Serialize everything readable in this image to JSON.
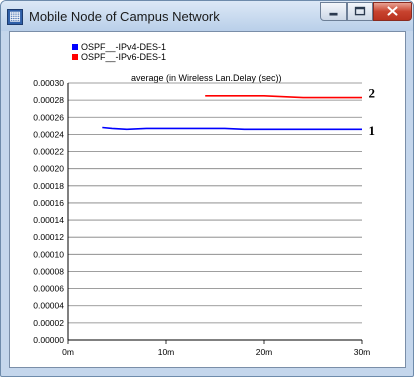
{
  "window": {
    "title": "Mobile Node of Campus Network",
    "icon": "app-window-icon",
    "controls": {
      "minimize": "minimize-icon",
      "maximize": "maximize-icon",
      "close": "close-icon"
    }
  },
  "legend": [
    {
      "label": "OSPF__-IPv4-DES-1",
      "color": "#0000ff"
    },
    {
      "label": "OSPF__-IPv6-DES-1",
      "color": "#ff0000"
    }
  ],
  "chart_data": {
    "type": "line",
    "title": "average (in Wireless Lan.Delay (sec))",
    "xlabel": "",
    "ylabel": "",
    "xlim": [
      0,
      30
    ],
    "ylim": [
      0,
      0.0003
    ],
    "x_ticks": [
      "0m",
      "10m",
      "20m",
      "30m"
    ],
    "y_ticks": [
      "0.00000",
      "0.00002",
      "0.00004",
      "0.00006",
      "0.00008",
      "0.00010",
      "0.00012",
      "0.00014",
      "0.00016",
      "0.00018",
      "0.00020",
      "0.00022",
      "0.00024",
      "0.00026",
      "0.00028",
      "0.00030"
    ],
    "grid": true,
    "legend_position": "top-left",
    "series": [
      {
        "name": "OSPF__-IPv4-DES-1",
        "color": "#0000ff",
        "x": [
          3.5,
          4.5,
          6,
          8,
          10,
          12,
          14,
          16,
          18,
          20,
          22,
          24,
          26,
          28,
          30
        ],
        "y": [
          0.000248,
          0.000247,
          0.000246,
          0.000247,
          0.000247,
          0.000247,
          0.000247,
          0.000247,
          0.000246,
          0.000246,
          0.000246,
          0.000246,
          0.000246,
          0.000246,
          0.000246
        ]
      },
      {
        "name": "OSPF__-IPv6-DES-1",
        "color": "#ff0000",
        "x": [
          14,
          16,
          18,
          20,
          22,
          24,
          26,
          28,
          30
        ],
        "y": [
          0.000285,
          0.000285,
          0.000285,
          0.000285,
          0.000284,
          0.000283,
          0.000283,
          0.000283,
          0.000283
        ]
      }
    ],
    "annotations": [
      {
        "text": "2",
        "x": 31,
        "y": 0.000288
      },
      {
        "text": "1",
        "x": 31,
        "y": 0.000244
      }
    ]
  }
}
